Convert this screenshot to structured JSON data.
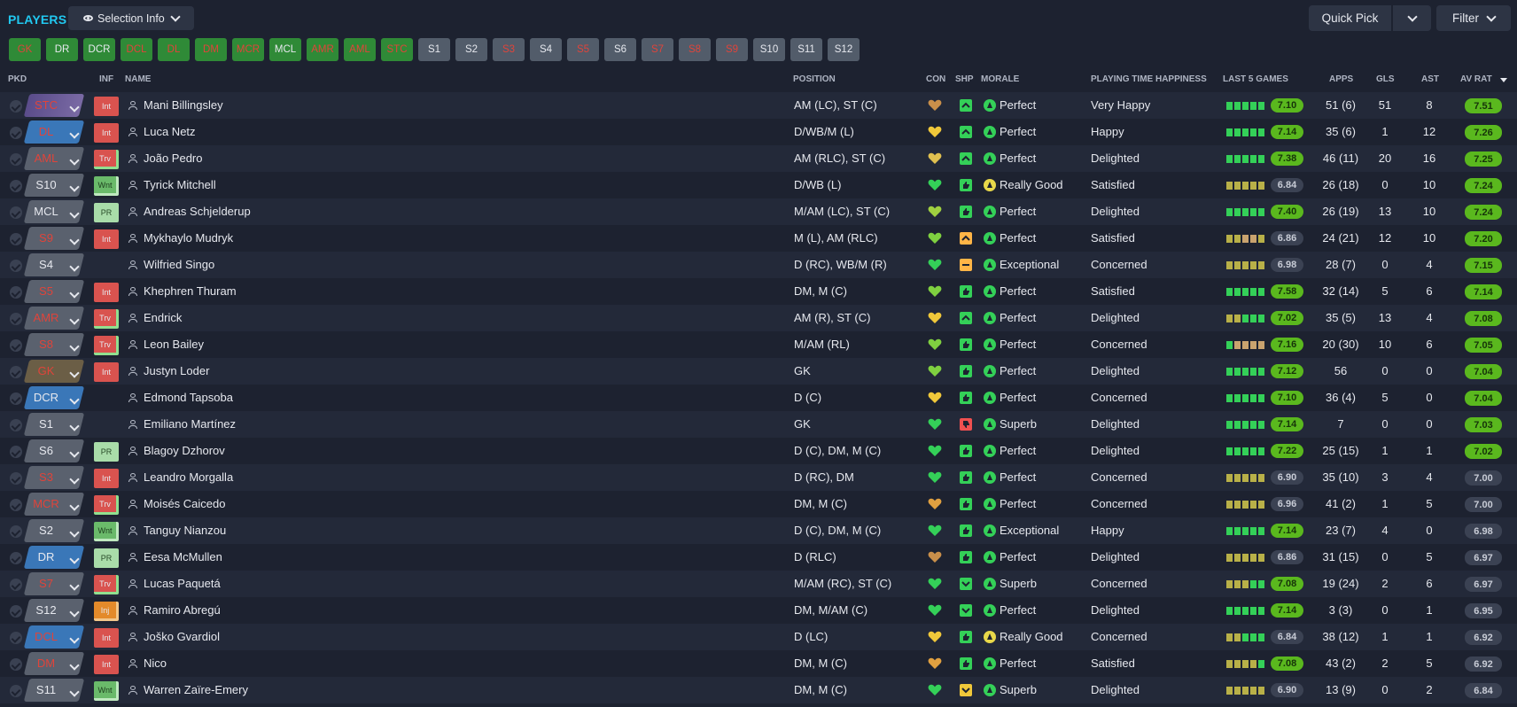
{
  "header": {
    "title": "PLAYERS",
    "selection_info": "Selection Info",
    "quick_pick": "Quick Pick",
    "filter": "Filter"
  },
  "chips": [
    {
      "label": "GK",
      "style": "g",
      "color": "#e0443a"
    },
    {
      "label": "DR",
      "style": "g",
      "color": "#e6e8ee"
    },
    {
      "label": "DCR",
      "style": "g",
      "color": "#e6e8ee"
    },
    {
      "label": "DCL",
      "style": "g",
      "color": "#e0443a"
    },
    {
      "label": "DL",
      "style": "g",
      "color": "#e0443a"
    },
    {
      "label": "DM",
      "style": "g",
      "color": "#e0443a"
    },
    {
      "label": "MCR",
      "style": "g",
      "color": "#e0443a"
    },
    {
      "label": "MCL",
      "style": "g",
      "color": "#e6e8ee"
    },
    {
      "label": "AMR",
      "style": "g",
      "color": "#e0443a"
    },
    {
      "label": "AML",
      "style": "g",
      "color": "#e0443a"
    },
    {
      "label": "STC",
      "style": "g",
      "color": "#e0443a"
    },
    {
      "label": "S1",
      "style": "s",
      "color": "#e6e8ee"
    },
    {
      "label": "S2",
      "style": "s",
      "color": "#e6e8ee"
    },
    {
      "label": "S3",
      "style": "s",
      "color": "#e0443a"
    },
    {
      "label": "S4",
      "style": "s",
      "color": "#e6e8ee"
    },
    {
      "label": "S5",
      "style": "s",
      "color": "#e0443a"
    },
    {
      "label": "S6",
      "style": "s",
      "color": "#e6e8ee"
    },
    {
      "label": "S7",
      "style": "s",
      "color": "#e0443a"
    },
    {
      "label": "S8",
      "style": "s",
      "color": "#e0443a"
    },
    {
      "label": "S9",
      "style": "s",
      "color": "#e0443a"
    },
    {
      "label": "S10",
      "style": "s",
      "color": "#e6e8ee"
    },
    {
      "label": "S11",
      "style": "s",
      "color": "#e6e8ee"
    },
    {
      "label": "S12",
      "style": "s",
      "color": "#e6e8ee"
    }
  ],
  "columns": {
    "pkd": "PKD",
    "inf": "INF",
    "name": "NAME",
    "position": "POSITION",
    "con": "CON",
    "shp": "SHP",
    "morale": "MORALE",
    "pth": "PLAYING TIME HAPPINESS",
    "last5": "LAST 5 GAMES",
    "apps": "APPS",
    "gls": "GLS",
    "ast": "AST",
    "avrat": "AV RAT"
  },
  "players": [
    {
      "pkd": "STC",
      "pkd_style": "purple",
      "pkd_color": "#e0443a",
      "inf": "Int",
      "inf_style": "int",
      "name": "Mani Billingsley",
      "position": "AM (LC), ST (C)",
      "heart": "#c98f4a",
      "shp": "green",
      "shp_icon": "up",
      "morale_icon": "green",
      "morale": "Perfect",
      "pth": "Very Happy",
      "bars": "ggggg",
      "rating": "7.10",
      "rating_style": "good",
      "apps": "51 (6)",
      "gls": "51",
      "ast": "8",
      "avrat": "7.51",
      "avrat_style": "good"
    },
    {
      "pkd": "DL",
      "pkd_style": "blue",
      "pkd_color": "#e0443a",
      "inf": "Int",
      "inf_style": "int",
      "name": "Luca Netz",
      "position": "D/WB/M (L)",
      "heart": "#f0c83a",
      "shp": "green",
      "shp_icon": "up",
      "morale_icon": "green",
      "morale": "Perfect",
      "pth": "Happy",
      "bars": "ggggg",
      "rating": "7.14",
      "rating_style": "good",
      "apps": "35 (6)",
      "gls": "1",
      "ast": "12",
      "avrat": "7.26",
      "avrat_style": "good"
    },
    {
      "pkd": "AML",
      "pkd_style": "grey",
      "pkd_color": "#e0443a",
      "inf": "Trv",
      "inf_style": "trv",
      "name": "João Pedro",
      "position": "AM (RLC), ST (C)",
      "heart": "#e0c050",
      "shp": "green",
      "shp_icon": "up",
      "morale_icon": "green",
      "morale": "Perfect",
      "pth": "Delighted",
      "bars": "ggggg",
      "rating": "7.38",
      "rating_style": "good",
      "apps": "46 (11)",
      "gls": "20",
      "ast": "16",
      "avrat": "7.25",
      "avrat_style": "good"
    },
    {
      "pkd": "S10",
      "pkd_style": "grey",
      "pkd_color": "#e6e8ee",
      "inf": "Wnt",
      "inf_style": "wnt",
      "name": "Tyrick Mitchell",
      "position": "D/WB (L)",
      "heart": "#34d058",
      "shp": "green",
      "shp_icon": "thumb",
      "morale_icon": "yellow",
      "morale": "Really Good",
      "pth": "Satisfied",
      "bars": "yyyyy",
      "rating": "6.84",
      "rating_style": "neut",
      "apps": "26 (18)",
      "gls": "0",
      "ast": "10",
      "avrat": "7.24",
      "avrat_style": "good"
    },
    {
      "pkd": "MCL",
      "pkd_style": "grey",
      "pkd_color": "#e6e8ee",
      "inf": "PR",
      "inf_style": "pr",
      "name": "Andreas Schjelderup",
      "position": "M/AM (LC), ST (C)",
      "heart": "#a0d040",
      "shp": "green",
      "shp_icon": "thumb",
      "morale_icon": "green",
      "morale": "Perfect",
      "pth": "Delighted",
      "bars": "ggggg",
      "rating": "7.40",
      "rating_style": "good",
      "apps": "26 (19)",
      "gls": "13",
      "ast": "10",
      "avrat": "7.24",
      "avrat_style": "good"
    },
    {
      "pkd": "S9",
      "pkd_style": "grey",
      "pkd_color": "#e0443a",
      "inf": "Int",
      "inf_style": "int",
      "name": "Mykhaylo Mudryk",
      "position": "M (L), AM (RLC)",
      "heart": "#7fd040",
      "shp": "orange",
      "shp_icon": "up",
      "morale_icon": "green",
      "morale": "Perfect",
      "pth": "Satisfied",
      "bars": "yyooy",
      "rating": "6.86",
      "rating_style": "neut",
      "apps": "24 (21)",
      "gls": "12",
      "ast": "10",
      "avrat": "7.20",
      "avrat_style": "good"
    },
    {
      "pkd": "S4",
      "pkd_style": "grey",
      "pkd_color": "#e6e8ee",
      "inf": "",
      "inf_style": "none",
      "name": "Wilfried Singo",
      "position": "D (RC), WB/M (R)",
      "heart": "#34d058",
      "shp": "orange",
      "shp_icon": "minus",
      "morale_icon": "green",
      "morale": "Exceptional",
      "pth": "Concerned",
      "bars": "yyyyy",
      "rating": "6.98",
      "rating_style": "neut",
      "apps": "28 (7)",
      "gls": "0",
      "ast": "4",
      "avrat": "7.15",
      "avrat_style": "good"
    },
    {
      "pkd": "S5",
      "pkd_style": "grey",
      "pkd_color": "#e0443a",
      "inf": "Int",
      "inf_style": "int",
      "name": "Khephren Thuram",
      "position": "DM, M (C)",
      "heart": "#7fd040",
      "shp": "green",
      "shp_icon": "thumb",
      "morale_icon": "green",
      "morale": "Perfect",
      "pth": "Satisfied",
      "bars": "ggggg",
      "rating": "7.58",
      "rating_style": "good",
      "apps": "32 (14)",
      "gls": "5",
      "ast": "6",
      "avrat": "7.14",
      "avrat_style": "good"
    },
    {
      "pkd": "AMR",
      "pkd_style": "grey",
      "pkd_color": "#e0443a",
      "inf": "Trv",
      "inf_style": "trv",
      "name": "Endrick",
      "position": "AM (R), ST (C)",
      "heart": "#f0c83a",
      "shp": "green",
      "shp_icon": "up",
      "morale_icon": "green",
      "morale": "Perfect",
      "pth": "Delighted",
      "bars": "yyggg",
      "rating": "7.02",
      "rating_style": "good",
      "apps": "35 (5)",
      "gls": "13",
      "ast": "4",
      "avrat": "7.08",
      "avrat_style": "good"
    },
    {
      "pkd": "S8",
      "pkd_style": "grey",
      "pkd_color": "#e0443a",
      "inf": "Trv",
      "inf_style": "trv",
      "name": "Leon Bailey",
      "position": "M/AM (RL)",
      "heart": "#7fd040",
      "shp": "green",
      "shp_icon": "thumb",
      "morale_icon": "green",
      "morale": "Perfect",
      "pth": "Concerned",
      "bars": "goooo",
      "rating": "7.16",
      "rating_style": "good",
      "apps": "20 (30)",
      "gls": "10",
      "ast": "6",
      "avrat": "7.05",
      "avrat_style": "good"
    },
    {
      "pkd": "GK",
      "pkd_style": "brown",
      "pkd_color": "#e0443a",
      "inf": "Int",
      "inf_style": "int",
      "name": "Justyn Loder",
      "position": "GK",
      "heart": "#7fd040",
      "shp": "green",
      "shp_icon": "thumb",
      "morale_icon": "green",
      "morale": "Perfect",
      "pth": "Delighted",
      "bars": "ggggg",
      "rating": "7.12",
      "rating_style": "good",
      "apps": "56",
      "gls": "0",
      "ast": "0",
      "avrat": "7.04",
      "avrat_style": "good"
    },
    {
      "pkd": "DCR",
      "pkd_style": "blue",
      "pkd_color": "#e6e8ee",
      "inf": "",
      "inf_style": "none",
      "name": "Edmond Tapsoba",
      "position": "D (C)",
      "heart": "#f0c83a",
      "shp": "green",
      "shp_icon": "thumb",
      "morale_icon": "green",
      "morale": "Perfect",
      "pth": "Concerned",
      "bars": "ggggg",
      "rating": "7.10",
      "rating_style": "good",
      "apps": "36 (4)",
      "gls": "5",
      "ast": "0",
      "avrat": "7.04",
      "avrat_style": "good"
    },
    {
      "pkd": "S1",
      "pkd_style": "grey",
      "pkd_color": "#e6e8ee",
      "inf": "",
      "inf_style": "none",
      "name": "Emiliano Martínez",
      "position": "GK",
      "heart": "#34d058",
      "shp": "red",
      "shp_icon": "thumbdown",
      "morale_icon": "green",
      "morale": "Superb",
      "pth": "Delighted",
      "bars": "ggggg",
      "rating": "7.14",
      "rating_style": "good",
      "apps": "7",
      "gls": "0",
      "ast": "0",
      "avrat": "7.03",
      "avrat_style": "good"
    },
    {
      "pkd": "S6",
      "pkd_style": "grey",
      "pkd_color": "#e6e8ee",
      "inf": "PR",
      "inf_style": "pr",
      "name": "Blagoy Dzhorov",
      "position": "D (C), DM, M (C)",
      "heart": "#34d058",
      "shp": "green",
      "shp_icon": "thumb",
      "morale_icon": "green",
      "morale": "Perfect",
      "pth": "Delighted",
      "bars": "ggggg",
      "rating": "7.22",
      "rating_style": "good",
      "apps": "25 (15)",
      "gls": "1",
      "ast": "1",
      "avrat": "7.02",
      "avrat_style": "good"
    },
    {
      "pkd": "S3",
      "pkd_style": "grey",
      "pkd_color": "#e0443a",
      "inf": "Int",
      "inf_style": "int",
      "name": "Leandro Morgalla",
      "position": "D (RC), DM",
      "heart": "#34d058",
      "shp": "green",
      "shp_icon": "thumb",
      "morale_icon": "green",
      "morale": "Perfect",
      "pth": "Concerned",
      "bars": "yyyyy",
      "rating": "6.90",
      "rating_style": "neut",
      "apps": "35 (10)",
      "gls": "3",
      "ast": "4",
      "avrat": "7.00",
      "avrat_style": "neut"
    },
    {
      "pkd": "MCR",
      "pkd_style": "grey",
      "pkd_color": "#e0443a",
      "inf": "Trv",
      "inf_style": "trv",
      "name": "Moisés Caicedo",
      "position": "DM, M (C)",
      "heart": "#e0a040",
      "shp": "green",
      "shp_icon": "thumb",
      "morale_icon": "green",
      "morale": "Perfect",
      "pth": "Concerned",
      "bars": "yyyyy",
      "rating": "6.96",
      "rating_style": "neut",
      "apps": "41 (2)",
      "gls": "1",
      "ast": "5",
      "avrat": "7.00",
      "avrat_style": "neut"
    },
    {
      "pkd": "S2",
      "pkd_style": "grey",
      "pkd_color": "#e6e8ee",
      "inf": "Wnt",
      "inf_style": "wnt",
      "name": "Tanguy Nianzou",
      "position": "D (C), DM, M (C)",
      "heart": "#34d058",
      "shp": "green",
      "shp_icon": "thumb",
      "morale_icon": "green",
      "morale": "Exceptional",
      "pth": "Happy",
      "bars": "ggggg",
      "rating": "7.14",
      "rating_style": "good",
      "apps": "23 (7)",
      "gls": "4",
      "ast": "0",
      "avrat": "6.98",
      "avrat_style": "neut"
    },
    {
      "pkd": "DR",
      "pkd_style": "blue",
      "pkd_color": "#e6e8ee",
      "inf": "PR",
      "inf_style": "pr",
      "name": "Eesa McMullen",
      "position": "D (RLC)",
      "heart": "#c98f4a",
      "shp": "green",
      "shp_icon": "thumb",
      "morale_icon": "green",
      "morale": "Perfect",
      "pth": "Delighted",
      "bars": "yyyyy",
      "rating": "6.86",
      "rating_style": "neut",
      "apps": "31 (15)",
      "gls": "0",
      "ast": "5",
      "avrat": "6.97",
      "avrat_style": "neut"
    },
    {
      "pkd": "S7",
      "pkd_style": "grey",
      "pkd_color": "#e0443a",
      "inf": "Trv",
      "inf_style": "trv",
      "name": "Lucas Paquetá",
      "position": "M/AM (RC), ST (C)",
      "heart": "#34d058",
      "shp": "green",
      "shp_icon": "down",
      "morale_icon": "green",
      "morale": "Superb",
      "pth": "Concerned",
      "bars": "yyygg",
      "rating": "7.08",
      "rating_style": "good",
      "apps": "19 (24)",
      "gls": "2",
      "ast": "6",
      "avrat": "6.97",
      "avrat_style": "neut"
    },
    {
      "pkd": "S12",
      "pkd_style": "grey",
      "pkd_color": "#e6e8ee",
      "inf": "Inj",
      "inf_style": "inj",
      "name": "Ramiro Abregú",
      "position": "DM, M/AM (C)",
      "heart": "#34d058",
      "shp": "green",
      "shp_icon": "down",
      "morale_icon": "green",
      "morale": "Perfect",
      "pth": "Delighted",
      "bars": "ggggg",
      "rating": "7.14",
      "rating_style": "good",
      "apps": "3 (3)",
      "gls": "0",
      "ast": "1",
      "avrat": "6.95",
      "avrat_style": "neut"
    },
    {
      "pkd": "DCL",
      "pkd_style": "blue",
      "pkd_color": "#e0443a",
      "inf": "Int",
      "inf_style": "int",
      "name": "Joško Gvardiol",
      "position": "D (LC)",
      "heart": "#f0c83a",
      "shp": "green",
      "shp_icon": "thumb",
      "morale_icon": "yellow",
      "morale": "Really Good",
      "pth": "Concerned",
      "bars": "yyggg",
      "rating": "6.84",
      "rating_style": "neut",
      "apps": "38 (12)",
      "gls": "1",
      "ast": "1",
      "avrat": "6.92",
      "avrat_style": "neut"
    },
    {
      "pkd": "DM",
      "pkd_style": "grey",
      "pkd_color": "#e0443a",
      "inf": "Int",
      "inf_style": "int",
      "name": "Nico",
      "position": "DM, M (C)",
      "heart": "#e0a040",
      "shp": "green",
      "shp_icon": "thumb",
      "morale_icon": "green",
      "morale": "Perfect",
      "pth": "Satisfied",
      "bars": "yyyyg",
      "rating": "7.08",
      "rating_style": "good",
      "apps": "43 (2)",
      "gls": "2",
      "ast": "5",
      "avrat": "6.92",
      "avrat_style": "neut"
    },
    {
      "pkd": "S11",
      "pkd_style": "grey",
      "pkd_color": "#e6e8ee",
      "inf": "Wnt",
      "inf_style": "wnt",
      "name": "Warren Zaïre-Emery",
      "position": "DM, M (C)",
      "heart": "#34d058",
      "shp": "yellow",
      "shp_icon": "down",
      "morale_icon": "green",
      "morale": "Superb",
      "pth": "Delighted",
      "bars": "yyyyy",
      "rating": "6.90",
      "rating_style": "neut",
      "apps": "13 (9)",
      "gls": "0",
      "ast": "2",
      "avrat": "6.84",
      "avrat_style": "neut"
    }
  ]
}
